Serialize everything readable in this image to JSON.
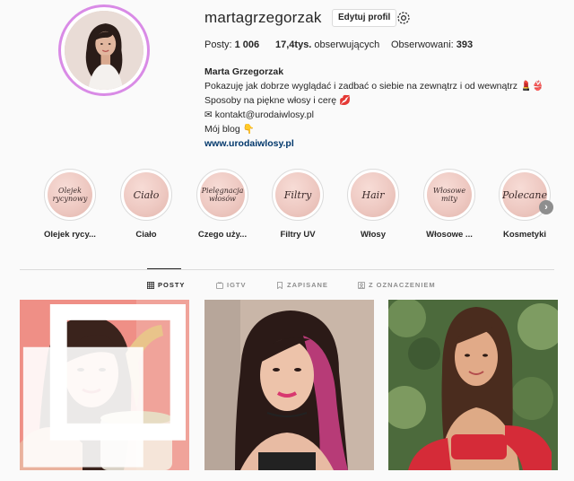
{
  "profile": {
    "username": "martagrzegorzak",
    "edit_label": "Edytuj profil",
    "stats": {
      "posts_label": "Posty: ",
      "posts_value": "1 006",
      "followers_value": "17,4tys.",
      "followers_label": " obserwujących",
      "following_label": "Obserwowani: ",
      "following_value": "393"
    },
    "bio": {
      "name": "Marta Grzegorzak",
      "line1": "Pokazuję jak dobrze wyglądać i zadbać o siebie na zewnątrz i od wewnątrz 💄👙",
      "line2": "Sposoby na piękne włosy i cerę 💋",
      "line3": "✉ kontakt@urodaiwlosy.pl",
      "line4": "Mój blog 👇",
      "website": "www.urodaiwlosy.pl"
    }
  },
  "highlights": [
    {
      "cover": "Olejek rycynowy",
      "label": "Olejek rycy..."
    },
    {
      "cover": "Ciało",
      "label": "Ciało"
    },
    {
      "cover": "Pielęgnacja włosów",
      "label": "Czego uży..."
    },
    {
      "cover": "Filtry",
      "label": "Filtry UV"
    },
    {
      "cover": "Hair",
      "label": "Włosy"
    },
    {
      "cover": "Włosowe mity",
      "label": "Włosowe ..."
    },
    {
      "cover": "Polecane",
      "label": "Kosmetyki"
    }
  ],
  "tabs": [
    {
      "label": "POSTY",
      "icon": "grid-icon",
      "active": true
    },
    {
      "label": "IGTV",
      "icon": "tv-icon",
      "active": false
    },
    {
      "label": "ZAPISANE",
      "icon": "bookmark-icon",
      "active": false
    },
    {
      "label": "Z OZNACZENIEM",
      "icon": "tag-icon",
      "active": false
    }
  ],
  "colors": {
    "avatar_ring": "#d98be6",
    "link": "#00376b",
    "highlight_cover": "#eec9c2"
  }
}
